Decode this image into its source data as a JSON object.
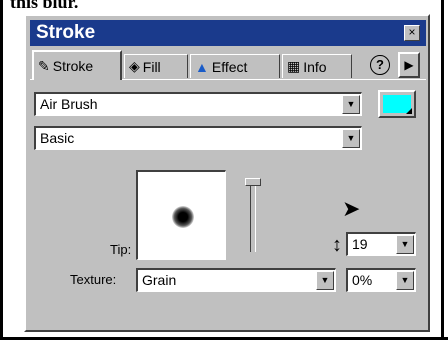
{
  "top_crop_text": "this blur.",
  "panel": {
    "title": "Stroke",
    "close_glyph": "×"
  },
  "tabs": [
    {
      "label": "Stroke",
      "icon": "brush-icon"
    },
    {
      "label": "Fill",
      "icon": "paint-bucket-icon"
    },
    {
      "label": "Effect",
      "icon": "effect-icon"
    },
    {
      "label": "Info",
      "icon": "info-icon"
    }
  ],
  "help_glyph": "?",
  "more_glyph": "▶",
  "stroke_category": "Air Brush",
  "stroke_type": "Basic",
  "stroke_color": "#00ffff",
  "tip_label": "Tip:",
  "tip_size": "19",
  "texture_label": "Texture:",
  "texture_value": "Grain",
  "texture_percent": "0%",
  "dropdown_glyph": "▼"
}
